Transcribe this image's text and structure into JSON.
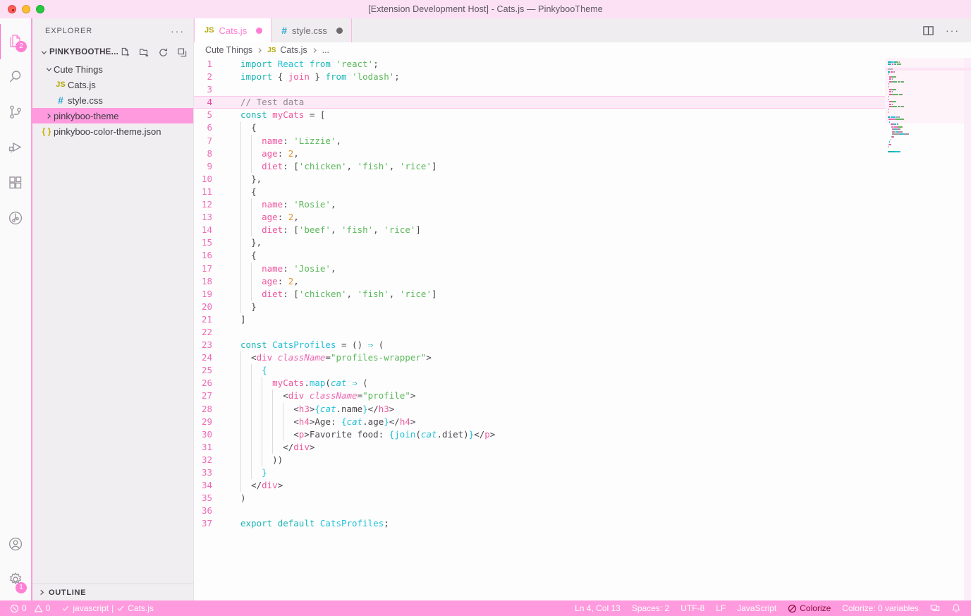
{
  "window": {
    "title": "[Extension Development Host] - Cats.js — PinkybooTheme"
  },
  "activity_bar": {
    "items": [
      {
        "name": "explorer",
        "icon": "files-icon",
        "badge": "2",
        "active": true
      },
      {
        "name": "search",
        "icon": "search-icon",
        "badge": "",
        "active": false
      },
      {
        "name": "source-control",
        "icon": "source-control-icon",
        "badge": "",
        "active": false
      },
      {
        "name": "run-debug",
        "icon": "run-debug-icon",
        "badge": "",
        "active": false
      },
      {
        "name": "extensions",
        "icon": "extensions-icon",
        "badge": "",
        "active": false
      },
      {
        "name": "testing",
        "icon": "testing-icon",
        "badge": "",
        "active": false
      }
    ],
    "bottom_items": [
      {
        "name": "accounts",
        "icon": "account-icon",
        "badge": ""
      },
      {
        "name": "settings",
        "icon": "gear-icon",
        "badge": "1"
      }
    ]
  },
  "sidebar": {
    "title": "EXPLORER",
    "more_actions": "···",
    "root": {
      "label": "PINKYBOOTHE...",
      "actions": [
        "new-file-icon",
        "new-folder-icon",
        "refresh-icon",
        "collapse-all-icon"
      ]
    },
    "tree": [
      {
        "label": "Cute Things",
        "icon": "folder",
        "depth": 1,
        "expanded": true,
        "selected": false
      },
      {
        "label": "Cats.js",
        "icon": "js",
        "depth": 2,
        "selected": false
      },
      {
        "label": "style.css",
        "icon": "css",
        "depth": 2,
        "selected": false
      },
      {
        "label": "pinkyboo-theme",
        "icon": "folder",
        "depth": 1,
        "expanded": false,
        "selected": true
      },
      {
        "label": "pinkyboo-color-theme.json",
        "icon": "json",
        "depth": 1,
        "selected": false
      }
    ],
    "outline": {
      "label": "OUTLINE",
      "expanded": false
    }
  },
  "editor": {
    "tabs": [
      {
        "label": "Cats.js",
        "icon": "js",
        "active": true,
        "dirty": true,
        "dirty_color": "#ff7fd4"
      },
      {
        "label": "style.css",
        "icon": "css",
        "active": false,
        "dirty": true,
        "dirty_color": "#6e6a70"
      }
    ],
    "actions": [
      "split-editor-icon",
      "more-actions-icon"
    ],
    "breadcrumbs": [
      "Cute Things",
      "Cats.js",
      "..."
    ],
    "current_line": 4,
    "lines": [
      {
        "n": 1,
        "tokens": [
          {
            "t": "import ",
            "c": "kw"
          },
          {
            "t": "React",
            "c": "id"
          },
          {
            "t": " ",
            "c": "txt"
          },
          {
            "t": "from",
            "c": "kw"
          },
          {
            "t": " ",
            "c": "txt"
          },
          {
            "t": "'react'",
            "c": "str"
          },
          {
            "t": ";",
            "c": "pun"
          }
        ]
      },
      {
        "n": 2,
        "tokens": [
          {
            "t": "import ",
            "c": "kw"
          },
          {
            "t": "{ ",
            "c": "pun"
          },
          {
            "t": "join",
            "c": "var"
          },
          {
            "t": " } ",
            "c": "pun"
          },
          {
            "t": "from",
            "c": "kw"
          },
          {
            "t": " ",
            "c": "txt"
          },
          {
            "t": "'lodash'",
            "c": "str"
          },
          {
            "t": ";",
            "c": "pun"
          }
        ]
      },
      {
        "n": 3,
        "tokens": []
      },
      {
        "n": 4,
        "tokens": [
          {
            "t": "// Test data",
            "c": "cmt"
          }
        ]
      },
      {
        "n": 5,
        "tokens": [
          {
            "t": "const",
            "c": "kw"
          },
          {
            "t": " ",
            "c": "txt"
          },
          {
            "t": "myCats",
            "c": "var"
          },
          {
            "t": " = ",
            "c": "pun"
          },
          {
            "t": "[",
            "c": "pun"
          }
        ]
      },
      {
        "n": 6,
        "tokens": [
          {
            "t": "  ",
            "c": "txt"
          },
          {
            "t": "{",
            "c": "pun"
          }
        ]
      },
      {
        "n": 7,
        "tokens": [
          {
            "t": "    ",
            "c": "txt"
          },
          {
            "t": "name",
            "c": "var"
          },
          {
            "t": ": ",
            "c": "pun"
          },
          {
            "t": "'Lizzie'",
            "c": "str"
          },
          {
            "t": ",",
            "c": "pun"
          }
        ]
      },
      {
        "n": 8,
        "tokens": [
          {
            "t": "    ",
            "c": "txt"
          },
          {
            "t": "age",
            "c": "var"
          },
          {
            "t": ": ",
            "c": "pun"
          },
          {
            "t": "2",
            "c": "num"
          },
          {
            "t": ",",
            "c": "pun"
          }
        ]
      },
      {
        "n": 9,
        "tokens": [
          {
            "t": "    ",
            "c": "txt"
          },
          {
            "t": "diet",
            "c": "var"
          },
          {
            "t": ": [",
            "c": "pun"
          },
          {
            "t": "'chicken'",
            "c": "str"
          },
          {
            "t": ", ",
            "c": "pun"
          },
          {
            "t": "'fish'",
            "c": "str"
          },
          {
            "t": ", ",
            "c": "pun"
          },
          {
            "t": "'rice'",
            "c": "str"
          },
          {
            "t": "]",
            "c": "pun"
          }
        ]
      },
      {
        "n": 10,
        "tokens": [
          {
            "t": "  ",
            "c": "txt"
          },
          {
            "t": "},",
            "c": "pun"
          }
        ]
      },
      {
        "n": 11,
        "tokens": [
          {
            "t": "  ",
            "c": "txt"
          },
          {
            "t": "{",
            "c": "pun"
          }
        ]
      },
      {
        "n": 12,
        "tokens": [
          {
            "t": "    ",
            "c": "txt"
          },
          {
            "t": "name",
            "c": "var"
          },
          {
            "t": ": ",
            "c": "pun"
          },
          {
            "t": "'Rosie'",
            "c": "str"
          },
          {
            "t": ",",
            "c": "pun"
          }
        ]
      },
      {
        "n": 13,
        "tokens": [
          {
            "t": "    ",
            "c": "txt"
          },
          {
            "t": "age",
            "c": "var"
          },
          {
            "t": ": ",
            "c": "pun"
          },
          {
            "t": "2",
            "c": "num"
          },
          {
            "t": ",",
            "c": "pun"
          }
        ]
      },
      {
        "n": 14,
        "tokens": [
          {
            "t": "    ",
            "c": "txt"
          },
          {
            "t": "diet",
            "c": "var"
          },
          {
            "t": ": [",
            "c": "pun"
          },
          {
            "t": "'beef'",
            "c": "str"
          },
          {
            "t": ", ",
            "c": "pun"
          },
          {
            "t": "'fish'",
            "c": "str"
          },
          {
            "t": ", ",
            "c": "pun"
          },
          {
            "t": "'rice'",
            "c": "str"
          },
          {
            "t": "]",
            "c": "pun"
          }
        ]
      },
      {
        "n": 15,
        "tokens": [
          {
            "t": "  ",
            "c": "txt"
          },
          {
            "t": "},",
            "c": "pun"
          }
        ]
      },
      {
        "n": 16,
        "tokens": [
          {
            "t": "  ",
            "c": "txt"
          },
          {
            "t": "{",
            "c": "pun"
          }
        ]
      },
      {
        "n": 17,
        "tokens": [
          {
            "t": "    ",
            "c": "txt"
          },
          {
            "t": "name",
            "c": "var"
          },
          {
            "t": ": ",
            "c": "pun"
          },
          {
            "t": "'Josie'",
            "c": "str"
          },
          {
            "t": ",",
            "c": "pun"
          }
        ]
      },
      {
        "n": 18,
        "tokens": [
          {
            "t": "    ",
            "c": "txt"
          },
          {
            "t": "age",
            "c": "var"
          },
          {
            "t": ": ",
            "c": "pun"
          },
          {
            "t": "2",
            "c": "num"
          },
          {
            "t": ",",
            "c": "pun"
          }
        ]
      },
      {
        "n": 19,
        "tokens": [
          {
            "t": "    ",
            "c": "txt"
          },
          {
            "t": "diet",
            "c": "var"
          },
          {
            "t": ": [",
            "c": "pun"
          },
          {
            "t": "'chicken'",
            "c": "str"
          },
          {
            "t": ", ",
            "c": "pun"
          },
          {
            "t": "'fish'",
            "c": "str"
          },
          {
            "t": ", ",
            "c": "pun"
          },
          {
            "t": "'rice'",
            "c": "str"
          },
          {
            "t": "]",
            "c": "pun"
          }
        ]
      },
      {
        "n": 20,
        "tokens": [
          {
            "t": "  ",
            "c": "txt"
          },
          {
            "t": "}",
            "c": "pun"
          }
        ]
      },
      {
        "n": 21,
        "tokens": [
          {
            "t": "]",
            "c": "pun"
          }
        ]
      },
      {
        "n": 22,
        "tokens": []
      },
      {
        "n": 23,
        "tokens": [
          {
            "t": "const",
            "c": "kw"
          },
          {
            "t": " ",
            "c": "txt"
          },
          {
            "t": "CatsProfiles",
            "c": "id"
          },
          {
            "t": " = () ",
            "c": "pun"
          },
          {
            "t": "⇒",
            "c": "kw"
          },
          {
            "t": " (",
            "c": "pun"
          }
        ]
      },
      {
        "n": 24,
        "tokens": [
          {
            "t": "  <",
            "c": "pun"
          },
          {
            "t": "div",
            "c": "tag"
          },
          {
            "t": " ",
            "c": "txt"
          },
          {
            "t": "className",
            "c": "attr"
          },
          {
            "t": "=",
            "c": "pun"
          },
          {
            "t": "\"profiles-wrapper\"",
            "c": "str"
          },
          {
            "t": ">",
            "c": "pun"
          }
        ]
      },
      {
        "n": 25,
        "tokens": [
          {
            "t": "    ",
            "c": "txt"
          },
          {
            "t": "{",
            "c": "brace"
          }
        ]
      },
      {
        "n": 26,
        "tokens": [
          {
            "t": "      ",
            "c": "txt"
          },
          {
            "t": "myCats",
            "c": "var"
          },
          {
            "t": ".",
            "c": "pun"
          },
          {
            "t": "map",
            "c": "fn"
          },
          {
            "t": "(",
            "c": "pun"
          },
          {
            "t": "cat",
            "c": "parm"
          },
          {
            "t": " ",
            "c": "txt"
          },
          {
            "t": "⇒",
            "c": "kw"
          },
          {
            "t": " (",
            "c": "pun"
          }
        ]
      },
      {
        "n": 27,
        "tokens": [
          {
            "t": "        <",
            "c": "pun"
          },
          {
            "t": "div",
            "c": "tag"
          },
          {
            "t": " ",
            "c": "txt"
          },
          {
            "t": "className",
            "c": "attr"
          },
          {
            "t": "=",
            "c": "pun"
          },
          {
            "t": "\"profile\"",
            "c": "str"
          },
          {
            "t": ">",
            "c": "pun"
          }
        ]
      },
      {
        "n": 28,
        "tokens": [
          {
            "t": "          <",
            "c": "pun"
          },
          {
            "t": "h3",
            "c": "tag"
          },
          {
            "t": ">",
            "c": "pun"
          },
          {
            "t": "{",
            "c": "brace"
          },
          {
            "t": "cat",
            "c": "parm"
          },
          {
            "t": ".",
            "c": "pun"
          },
          {
            "t": "name",
            "c": "txt"
          },
          {
            "t": "}",
            "c": "brace"
          },
          {
            "t": "</",
            "c": "pun"
          },
          {
            "t": "h3",
            "c": "tag"
          },
          {
            "t": ">",
            "c": "pun"
          }
        ]
      },
      {
        "n": 29,
        "tokens": [
          {
            "t": "          <",
            "c": "pun"
          },
          {
            "t": "h4",
            "c": "tag"
          },
          {
            "t": ">",
            "c": "pun"
          },
          {
            "t": "Age: ",
            "c": "txt"
          },
          {
            "t": "{",
            "c": "brace"
          },
          {
            "t": "cat",
            "c": "parm"
          },
          {
            "t": ".",
            "c": "pun"
          },
          {
            "t": "age",
            "c": "txt"
          },
          {
            "t": "}",
            "c": "brace"
          },
          {
            "t": "</",
            "c": "pun"
          },
          {
            "t": "h4",
            "c": "tag"
          },
          {
            "t": ">",
            "c": "pun"
          }
        ]
      },
      {
        "n": 30,
        "tokens": [
          {
            "t": "          <",
            "c": "pun"
          },
          {
            "t": "p",
            "c": "tag"
          },
          {
            "t": ">",
            "c": "pun"
          },
          {
            "t": "Favorite food: ",
            "c": "txt"
          },
          {
            "t": "{",
            "c": "brace"
          },
          {
            "t": "join",
            "c": "fn"
          },
          {
            "t": "(",
            "c": "pun"
          },
          {
            "t": "cat",
            "c": "parm"
          },
          {
            "t": ".",
            "c": "pun"
          },
          {
            "t": "diet",
            "c": "txt"
          },
          {
            "t": ")",
            "c": "pun"
          },
          {
            "t": "}",
            "c": "brace"
          },
          {
            "t": "</",
            "c": "pun"
          },
          {
            "t": "p",
            "c": "tag"
          },
          {
            "t": ">",
            "c": "pun"
          }
        ]
      },
      {
        "n": 31,
        "tokens": [
          {
            "t": "        </",
            "c": "pun"
          },
          {
            "t": "div",
            "c": "tag"
          },
          {
            "t": ">",
            "c": "pun"
          }
        ]
      },
      {
        "n": 32,
        "tokens": [
          {
            "t": "      ))",
            "c": "pun"
          }
        ]
      },
      {
        "n": 33,
        "tokens": [
          {
            "t": "    ",
            "c": "txt"
          },
          {
            "t": "}",
            "c": "brace"
          }
        ]
      },
      {
        "n": 34,
        "tokens": [
          {
            "t": "  </",
            "c": "pun"
          },
          {
            "t": "div",
            "c": "tag"
          },
          {
            "t": ">",
            "c": "pun"
          }
        ]
      },
      {
        "n": 35,
        "tokens": [
          {
            "t": ")",
            "c": "pun"
          }
        ]
      },
      {
        "n": 36,
        "tokens": []
      },
      {
        "n": 37,
        "tokens": [
          {
            "t": "export",
            "c": "kw"
          },
          {
            "t": " ",
            "c": "txt"
          },
          {
            "t": "default",
            "c": "kw"
          },
          {
            "t": " ",
            "c": "txt"
          },
          {
            "t": "CatsProfiles",
            "c": "id"
          },
          {
            "t": ";",
            "c": "pun"
          }
        ]
      }
    ]
  },
  "status_bar": {
    "errors": "0",
    "warnings": "0",
    "eslint_language": "javascript",
    "eslint_separator": "|",
    "eslint_file": "Cats.js",
    "position": "Ln 4, Col 13",
    "indentation": "Spaces: 2",
    "encoding": "UTF-8",
    "eol": "LF",
    "language": "JavaScript",
    "colorize": "Colorize",
    "colorize_variables": "Colorize: 0 variables",
    "background": "#ff9ade",
    "colorize_color": "#8d1040"
  }
}
